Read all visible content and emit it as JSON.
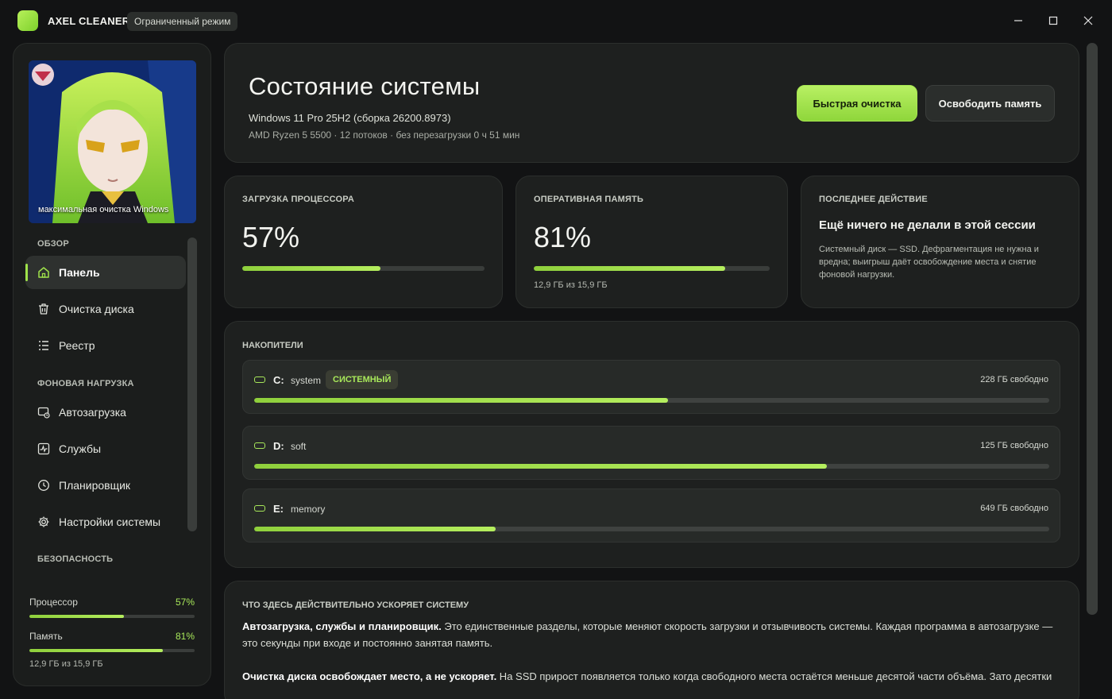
{
  "app": {
    "title": "AXEL CLEANER",
    "mode_badge": "Ограниченный режим",
    "accent": "#9fe24a"
  },
  "sidebar": {
    "banner_caption": "максимальная очистка Windows",
    "sections": {
      "overview": "ОБЗОР",
      "background": "ФОНОВАЯ НАГРУЗКА",
      "security": "БЕЗОПАСНОСТЬ"
    },
    "items": [
      {
        "label": "Панель",
        "icon": "home-icon",
        "active": true
      },
      {
        "label": "Очистка диска",
        "icon": "trash-icon"
      },
      {
        "label": "Реестр",
        "icon": "list-icon"
      },
      {
        "label": "Автозагрузка",
        "icon": "startup-icon"
      },
      {
        "label": "Службы",
        "icon": "activity-icon"
      },
      {
        "label": "Планировщик",
        "icon": "clock-icon"
      },
      {
        "label": "Настройки системы",
        "icon": "gear-icon"
      }
    ],
    "mini": {
      "cpu_label": "Процессор",
      "cpu_value": "57%",
      "cpu_percent": 57,
      "mem_label": "Память",
      "mem_value": "81%",
      "mem_percent": 81,
      "mem_sub": "12,9 ГБ из 15,9 ГБ"
    }
  },
  "hero": {
    "title": "Состояние системы",
    "os": "Windows 11 Pro 25H2 (сборка 26200.8973)",
    "cpu": "AMD Ryzen 5 5500 · 12 потоков · без перезагрузки 0 ч 51 мин",
    "primary_button": "Быстрая очистка",
    "secondary_button": "Освободить память"
  },
  "stats": {
    "cpu": {
      "label": "Загрузка процессора",
      "value": "57%",
      "percent": 57
    },
    "ram": {
      "label": "Оперативная память",
      "value": "81%",
      "percent": 81,
      "sub": "12,9 ГБ из 15,9 ГБ"
    },
    "last": {
      "label": "Последнее действие",
      "title": "Ещё ничего не делали в этой сессии",
      "desc": "Системный диск — SSD. Дефрагментация не нужна и вредна; выигрыш даёт освобождение места и снятие фоновой нагрузки."
    }
  },
  "drives": {
    "label": "Накопители",
    "items": [
      {
        "letter": "C:",
        "name": "system",
        "tag": "СИСТЕМНЫЙ",
        "free": "228 ГБ свободно",
        "used_percent": 52
      },
      {
        "letter": "D:",
        "name": "soft",
        "tag": "",
        "free": "125 ГБ свободно",
        "used_percent": 72
      },
      {
        "letter": "E:",
        "name": "memory",
        "tag": "",
        "free": "649 ГБ свободно",
        "used_percent": 30.4
      }
    ]
  },
  "tips": {
    "label": "Что здесь действительно ускоряет систему",
    "p1_bold": "Автозагрузка, службы и планировщик.",
    "p1_text": " Это единственные разделы, которые меняют скорость загрузки и отзывчивость системы. Каждая программа в автозагрузке — это секунды при входе и постоянно занятая память.",
    "p2_bold": "Очистка диска освобождает место, а не ускоряет.",
    "p2_text": " На SSD прирост появляется только когда свободного места остаётся меньше десятой части объёма. Зато десятки"
  }
}
